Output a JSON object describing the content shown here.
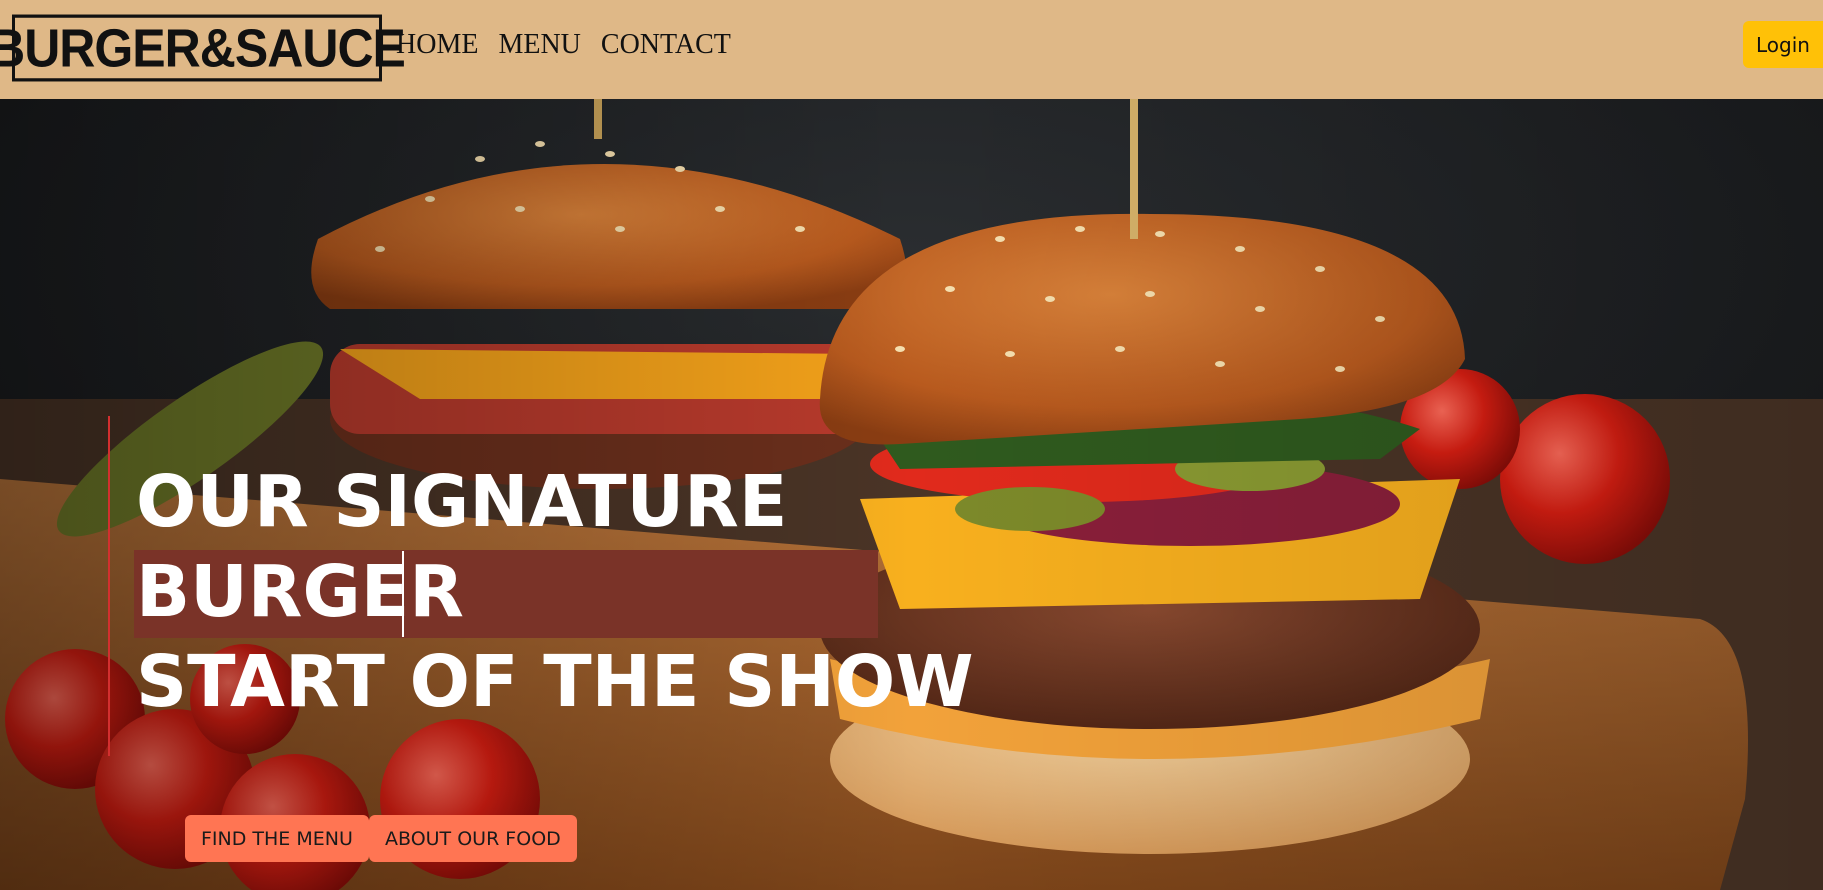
{
  "brand": {
    "logo_text": "BURGER&SAUCE"
  },
  "nav": {
    "items": [
      {
        "label": "HOME"
      },
      {
        "label": "MENU"
      },
      {
        "label": "CONTACT"
      }
    ],
    "login_label": "Login"
  },
  "hero": {
    "line1": "OUR SIGNATURE",
    "line2": "BURGER",
    "line3": "START OF THE SHOW",
    "buttons": [
      {
        "label": "FIND THE MENU"
      },
      {
        "label": "ABOUT OUR FOOD"
      }
    ]
  },
  "colors": {
    "navbar": "#dfb887",
    "login": "#ffc107",
    "cta": "#ff7553",
    "highlight": "#7a3328",
    "accent_line": "#d32f2f"
  }
}
